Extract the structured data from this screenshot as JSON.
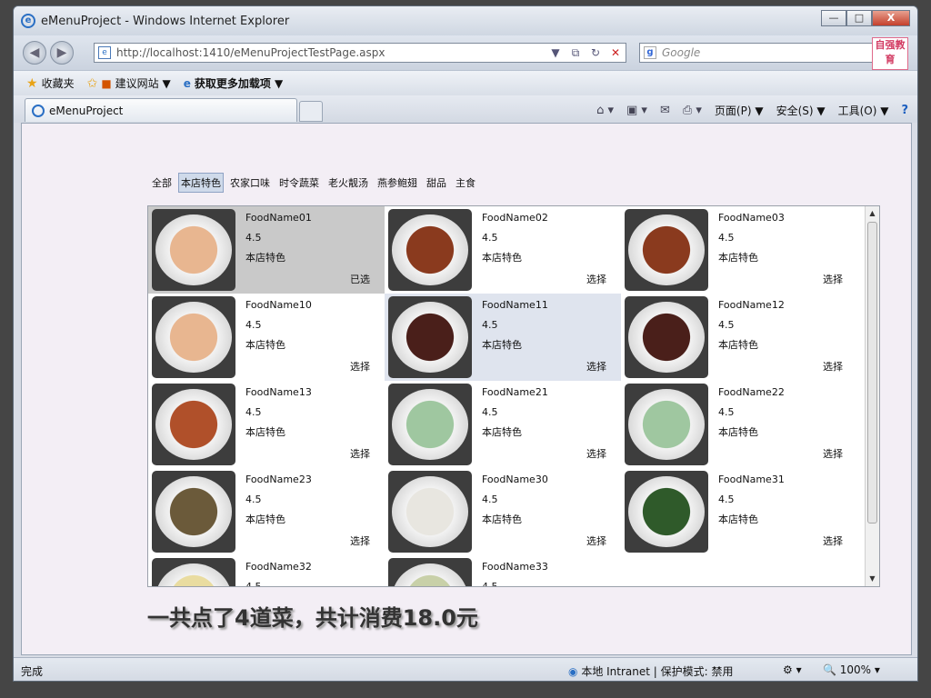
{
  "window": {
    "title": "eMenuProject - Windows Internet Explorer",
    "min": "—",
    "max": "□",
    "close": "X"
  },
  "address": {
    "url": "http://localhost:1410/eMenuProjectTestPage.aspx",
    "search_placeholder": "Google"
  },
  "brand_logo": "自强教育",
  "favorites": {
    "label": "收藏夹",
    "suggest": "建议网站 ▼",
    "more": "获取更多加载项 ▼"
  },
  "tab": {
    "label": "eMenuProject"
  },
  "commands": {
    "page": "页面(P) ▼",
    "safety": "安全(S) ▼",
    "tools": "工具(O) ▼",
    "help": "?"
  },
  "categories": [
    "全部",
    "本店特色",
    "农家口味",
    "时令蔬菜",
    "老火靓汤",
    "燕参鲍翅",
    "甜品",
    "主食"
  ],
  "selected_category": "本店特色",
  "foods": [
    {
      "name": "FoodName01",
      "score": "4.5",
      "cat": "本店特色",
      "action": "已选",
      "plate": "#e8b690"
    },
    {
      "name": "FoodName02",
      "score": "4.5",
      "cat": "本店特色",
      "action": "选择",
      "plate": "#8a3a1e"
    },
    {
      "name": "FoodName03",
      "score": "4.5",
      "cat": "本店特色",
      "action": "选择",
      "plate": "#8a3a1e"
    },
    {
      "name": "FoodName10",
      "score": "4.5",
      "cat": "本店特色",
      "action": "选择",
      "plate": "#e8b690"
    },
    {
      "name": "FoodName11",
      "score": "4.5",
      "cat": "本店特色",
      "action": "选择",
      "plate": "#4a1f1a"
    },
    {
      "name": "FoodName12",
      "score": "4.5",
      "cat": "本店特色",
      "action": "选择",
      "plate": "#4a1f1a"
    },
    {
      "name": "FoodName13",
      "score": "4.5",
      "cat": "本店特色",
      "action": "选择",
      "plate": "#b0502a"
    },
    {
      "name": "FoodName21",
      "score": "4.5",
      "cat": "本店特色",
      "action": "选择",
      "plate": "#9fc7a0"
    },
    {
      "name": "FoodName22",
      "score": "4.5",
      "cat": "本店特色",
      "action": "选择",
      "plate": "#9fc7a0"
    },
    {
      "name": "FoodName23",
      "score": "4.5",
      "cat": "本店特色",
      "action": "选择",
      "plate": "#6b5a3a"
    },
    {
      "name": "FoodName30",
      "score": "4.5",
      "cat": "本店特色",
      "action": "选择",
      "plate": "#e8e6e0"
    },
    {
      "name": "FoodName31",
      "score": "4.5",
      "cat": "本店特色",
      "action": "选择",
      "plate": "#2f5a2a"
    },
    {
      "name": "FoodName32",
      "score": "4.5",
      "cat": "",
      "action": "",
      "plate": "#e9dca0"
    },
    {
      "name": "FoodName33",
      "score": "4.5",
      "cat": "",
      "action": "",
      "plate": "#c8d0a8"
    }
  ],
  "summary": "一共点了4道菜，共计消费18.0元",
  "status": {
    "text": "完成",
    "zone": "本地 Intranet | 保护模式: 禁用",
    "zoom": "100%"
  }
}
